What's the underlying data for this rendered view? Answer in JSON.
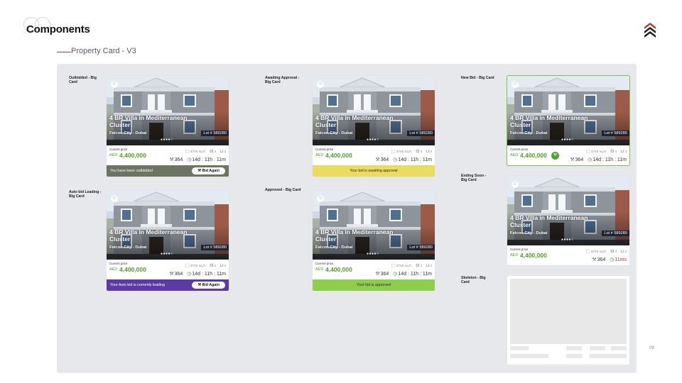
{
  "page": {
    "title": "Components",
    "subtitle": "Property Card - V3",
    "page_number": "09"
  },
  "colors": {
    "accent_green": "#4ea129",
    "outbid": "#6b7560",
    "awaiting": "#e9dc5e",
    "leading": "#5b3aa5",
    "approved": "#8fce4d",
    "lot_bg": "#1d2230",
    "board": "#e7e8ec"
  },
  "icons": [
    "heart-icon",
    "area-icon",
    "bed-icon",
    "bath-icon",
    "gavel-icon",
    "eye-icon",
    "clock-icon",
    "brand-chevrons-icon"
  ],
  "labels": {
    "outbidded": "Outbidded - Big Card",
    "awaiting": "Awaiting Approval - Big Card",
    "new_bid": "New Bid - Big Card",
    "auto_bid": "Auto bid Leading - Big Card",
    "approved": "Approved - Big Card",
    "ending_soon": "Ending Soon - Big Card",
    "skeleton": "Skeleton - Big Card"
  },
  "card": {
    "title": "4 BR Villa in Mediterranean Cluster",
    "location": "Falcon City - Dubai",
    "lot": "Lot # 589280",
    "carousel_dots": "●●●●○",
    "current_price_label": "Current price",
    "currency": "AED",
    "price": "4,400,000",
    "area": "3745 sq.ft.",
    "beds": "4",
    "baths": "3",
    "bids": "364",
    "time_left": "14d : 11h : 11m",
    "time_left_urgent": "11ms"
  },
  "footers": {
    "outbid_text": "You have been outbidded",
    "bid_again": "Bid Again",
    "awaiting_text": "Your bid is awaiting approval",
    "leading_text": "Your Auto bid is currently leading",
    "approved_text": "Your bid is approved"
  }
}
